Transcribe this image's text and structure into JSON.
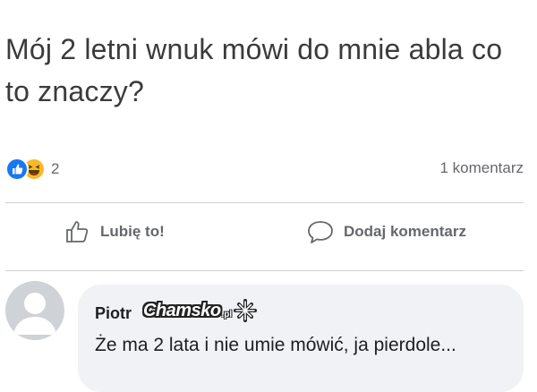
{
  "post": {
    "text": "Mój 2 letni wnuk mówi do mnie abla co to znaczy?"
  },
  "stats": {
    "reaction_count": "2",
    "reaction_icons": [
      "like-icon",
      "haha-icon"
    ],
    "comment_count": "1 komentarz"
  },
  "actions": {
    "like_label": "Lubię to!",
    "comment_label": "Dodaj komentarz"
  },
  "comment": {
    "author": "Piotr",
    "text": "Że ma 2 lata i nie umie mówić, ja pierdole...",
    "watermark": "Chamsko",
    "watermark_suffix": ".pl"
  },
  "colors": {
    "like_blue": "#1877f2",
    "haha_yellow": "#f7b928",
    "muted_text": "#65676b",
    "bubble_bg": "#f0f2f5"
  }
}
